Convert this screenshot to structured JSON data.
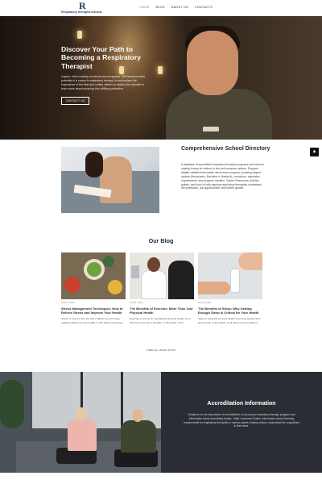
{
  "header": {
    "logo_mark": "R",
    "logo_text": "Respiratory therapist schools",
    "nav": [
      "HOME",
      "BLOG",
      "ABOUT US",
      "CONTACTS"
    ],
    "active_nav": "HOME"
  },
  "hero": {
    "title": "Discover Your Path to Becoming a Respiratory Therapist",
    "subtitle": "explore, with a variety of schools and programs. The transformative potential of a career in respiratory therapy. It emphasizes the importance of the field and invites visitors to explore the website to learn more about pursuing this fulfilling profession.",
    "button": "CONTACT US"
  },
  "directory": {
    "title": "Comprehensive School Directory",
    "text": "A database of accredited respiratory therapist programs and schools, making it easy for visitors to find and compare options. Program details: detailed information about each program, including degree options (Associate's, Bachelor's, Master's), curriculum, admission requirements, and program duration. Career Resources: Articles, guides, and tools to help aspiring respiratory therapists understand the profession, job opportunities, and career growth."
  },
  "blog": {
    "heading": "Our Blog",
    "posts": [
      {
        "date": "JUN 8, 2024",
        "title": "Stress Management Techniques: How to Relieve Stress and Improve Your Health",
        "excerpt": "Stress is a part of life, but how it affects you can have negative effects on your health. In this article we'll share..."
      },
      {
        "date": "JUN 8, 2024",
        "title": "The Benefits of Exercise: More Than Just Physical Health",
        "excerpt": "Exercise is crucial for maintaining physical health, but it also has many other benefits. In this article, we'll..."
      },
      {
        "date": "JUN 8, 2024",
        "title": "The Benefits of Sleep: Why Getting Enough Sleep is Critical for Your Health",
        "excerpt": "Sleep is essential for good health, but many people don't get enough. In this article, we'll discuss the benefits of..."
      }
    ],
    "view_all": "VIEW ALL BLOG POST"
  },
  "accreditation": {
    "title": "Accreditation Information",
    "text": "Guidance on the importance of accreditation in choosing a respiratory therapy program and information about accrediting bodies. State Licensure Guides: Information about licensing requirements for respiratory therapists in various states, helping visitors understand the regulations in their area."
  },
  "colors": {
    "accent": "#e05260",
    "brand": "#1e3a5f",
    "dark_panel": "#2a2d33"
  }
}
